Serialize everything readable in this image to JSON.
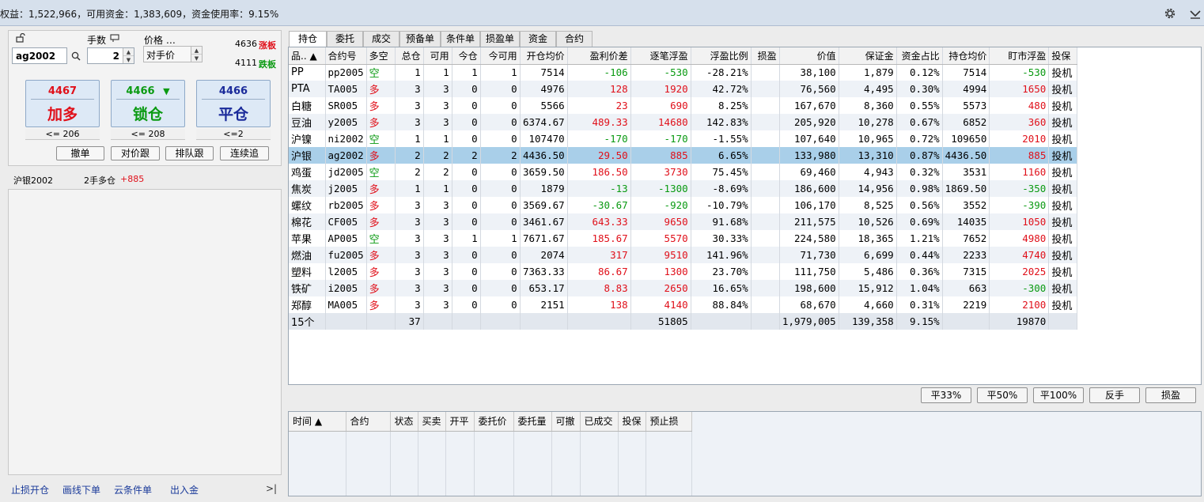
{
  "topbar": {
    "summary": "权益：1,522,966，可用资金：1,383,609，资金使用率：9.15%",
    "icons": [
      "gear-icon",
      "chevron-down-icon"
    ]
  },
  "order": {
    "lock_icon": "unlock-icon",
    "qty_label": "手数",
    "qty_icon": "tag-icon",
    "price_label": "价格 …",
    "contract": "ag2002",
    "qty": "2",
    "price_mode": "对手价",
    "limit_up_value": "4636",
    "limit_up_label": "涨板",
    "limit_down_value": "4111",
    "limit_down_label": "跌板",
    "buttons": [
      {
        "price": "4467",
        "label": "加多",
        "cap": "<= 206",
        "color": "#e0101a"
      },
      {
        "price": "4466",
        "label": "锁仓",
        "cap": "<= 208",
        "color": "#0a9a12",
        "arrow": "▼"
      },
      {
        "price": "4466",
        "label": "平仓",
        "cap": "<=2",
        "color": "#1a2a9a"
      }
    ],
    "small_buttons": [
      "撤单",
      "对价跟",
      "排队跟",
      "连续追"
    ]
  },
  "position_summary": {
    "name": "沪银2002",
    "desc": "2手多仓",
    "pnl": "+885"
  },
  "left_links": [
    "止损开仓",
    "画线下单",
    "云条件单",
    "出入金",
    ">|"
  ],
  "tabs": [
    "持仓",
    "委托",
    "成交",
    "预备单",
    "条件单",
    "损盈单",
    "资金",
    "合约"
  ],
  "positions": {
    "headers": [
      "品.. ▲",
      "合约号",
      "多空",
      "总仓",
      "可用",
      "今仓",
      "今可用",
      "开仓均价",
      "盈利价差",
      "逐笔浮盈",
      "浮盈比例",
      "损盈",
      "价值",
      "保证金",
      "资金占比",
      "持仓均价",
      "盯市浮盈",
      "投保"
    ],
    "rows": [
      [
        "PP",
        "pp2005",
        "空",
        "1",
        "1",
        "1",
        "1",
        "7514",
        "-106",
        "-530",
        "-28.21%",
        "",
        "38,100",
        "1,879",
        "0.12%",
        "7514",
        "-530",
        "投机"
      ],
      [
        "PTA",
        "TA005",
        "多",
        "3",
        "3",
        "0",
        "0",
        "4976",
        "128",
        "1920",
        "42.72%",
        "",
        "76,560",
        "4,495",
        "0.30%",
        "4994",
        "1650",
        "投机"
      ],
      [
        "白糖",
        "SR005",
        "多",
        "3",
        "3",
        "0",
        "0",
        "5566",
        "23",
        "690",
        "8.25%",
        "",
        "167,670",
        "8,360",
        "0.55%",
        "5573",
        "480",
        "投机"
      ],
      [
        "豆油",
        "y2005",
        "多",
        "3",
        "3",
        "0",
        "0",
        "6374.67",
        "489.33",
        "14680",
        "142.83%",
        "",
        "205,920",
        "10,278",
        "0.67%",
        "6852",
        "360",
        "投机"
      ],
      [
        "沪镍",
        "ni2002",
        "空",
        "1",
        "1",
        "0",
        "0",
        "107470",
        "-170",
        "-170",
        "-1.55%",
        "",
        "107,640",
        "10,965",
        "0.72%",
        "109650",
        "2010",
        "投机"
      ],
      [
        "沪银",
        "ag2002",
        "多",
        "2",
        "2",
        "2",
        "2",
        "4436.50",
        "29.50",
        "885",
        "6.65%",
        "",
        "133,980",
        "13,310",
        "0.87%",
        "4436.50",
        "885",
        "投机"
      ],
      [
        "鸡蛋",
        "jd2005",
        "空",
        "2",
        "2",
        "0",
        "0",
        "3659.50",
        "186.50",
        "3730",
        "75.45%",
        "",
        "69,460",
        "4,943",
        "0.32%",
        "3531",
        "1160",
        "投机"
      ],
      [
        "焦炭",
        "j2005",
        "多",
        "1",
        "1",
        "0",
        "0",
        "1879",
        "-13",
        "-1300",
        "-8.69%",
        "",
        "186,600",
        "14,956",
        "0.98%",
        "1869.50",
        "-350",
        "投机"
      ],
      [
        "螺纹",
        "rb2005",
        "多",
        "3",
        "3",
        "0",
        "0",
        "3569.67",
        "-30.67",
        "-920",
        "-10.79%",
        "",
        "106,170",
        "8,525",
        "0.56%",
        "3552",
        "-390",
        "投机"
      ],
      [
        "棉花",
        "CF005",
        "多",
        "3",
        "3",
        "0",
        "0",
        "3461.67",
        "643.33",
        "9650",
        "91.68%",
        "",
        "211,575",
        "10,526",
        "0.69%",
        "14035",
        "1050",
        "投机"
      ],
      [
        "苹果",
        "AP005",
        "空",
        "3",
        "3",
        "1",
        "1",
        "7671.67",
        "185.67",
        "5570",
        "30.33%",
        "",
        "224,580",
        "18,365",
        "1.21%",
        "7652",
        "4980",
        "投机"
      ],
      [
        "燃油",
        "fu2005",
        "多",
        "3",
        "3",
        "0",
        "0",
        "2074",
        "317",
        "9510",
        "141.96%",
        "",
        "71,730",
        "6,699",
        "0.44%",
        "2233",
        "4740",
        "投机"
      ],
      [
        "塑料",
        "l2005",
        "多",
        "3",
        "3",
        "0",
        "0",
        "7363.33",
        "86.67",
        "1300",
        "23.70%",
        "",
        "111,750",
        "5,486",
        "0.36%",
        "7315",
        "2025",
        "投机"
      ],
      [
        "铁矿",
        "i2005",
        "多",
        "3",
        "3",
        "0",
        "0",
        "653.17",
        "8.83",
        "2650",
        "16.65%",
        "",
        "198,600",
        "15,912",
        "1.04%",
        "663",
        "-300",
        "投机"
      ],
      [
        "郑醇",
        "MA005",
        "多",
        "3",
        "3",
        "0",
        "0",
        "2151",
        "138",
        "4140",
        "88.84%",
        "",
        "68,670",
        "4,660",
        "0.31%",
        "2219",
        "2100",
        "投机"
      ]
    ],
    "total": [
      "15个",
      "",
      "",
      "37",
      "",
      "",
      "",
      "",
      "",
      "51805",
      "",
      "",
      "1,979,005",
      "139,358",
      "9.15%",
      "",
      "19870",
      ""
    ],
    "selected_row": 5
  },
  "actions": [
    "平33%",
    "平50%",
    "平100%",
    "反手",
    "损盈"
  ],
  "orders": {
    "headers": [
      "时间 ▲",
      "合约",
      "状态",
      "买卖",
      "开平",
      "委托价",
      "委托量",
      "可撤",
      "已成交",
      "投保",
      "预止损"
    ]
  },
  "colors": {
    "up": "#e0101a",
    "down": "#0a9a12",
    "blue": "#1a2a9a",
    "selected": "#a9cfe9"
  }
}
